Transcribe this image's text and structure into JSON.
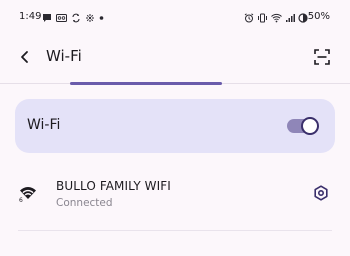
{
  "status_bar": {
    "time": "1:49",
    "battery": "50%",
    "left_icons": [
      "chat-bubble-icon",
      "voicemail-icon",
      "recycle-icon",
      "flower-icon",
      "dot-icon"
    ],
    "right_icons": [
      "alarm-icon",
      "vibrate-icon",
      "wifi-signal-icon",
      "cell-signal-icon",
      "battery-icon"
    ]
  },
  "toolbar": {
    "title": "Wi-Fi",
    "back_icon": "back-arrow-icon",
    "qr_icon": "qr-scan-icon"
  },
  "wifi_toggle": {
    "label": "Wi-Fi",
    "enabled": true
  },
  "networks": [
    {
      "ssid": "BULLO FAMILY WIFI",
      "status": "Connected",
      "icon": "wifi-6-icon",
      "settings_icon": "gear-icon"
    }
  ],
  "colors": {
    "background": "#fcf7fb",
    "card": "#e4e2f8",
    "accent": "#6a5cab",
    "switch_track": "#8f86b8"
  }
}
